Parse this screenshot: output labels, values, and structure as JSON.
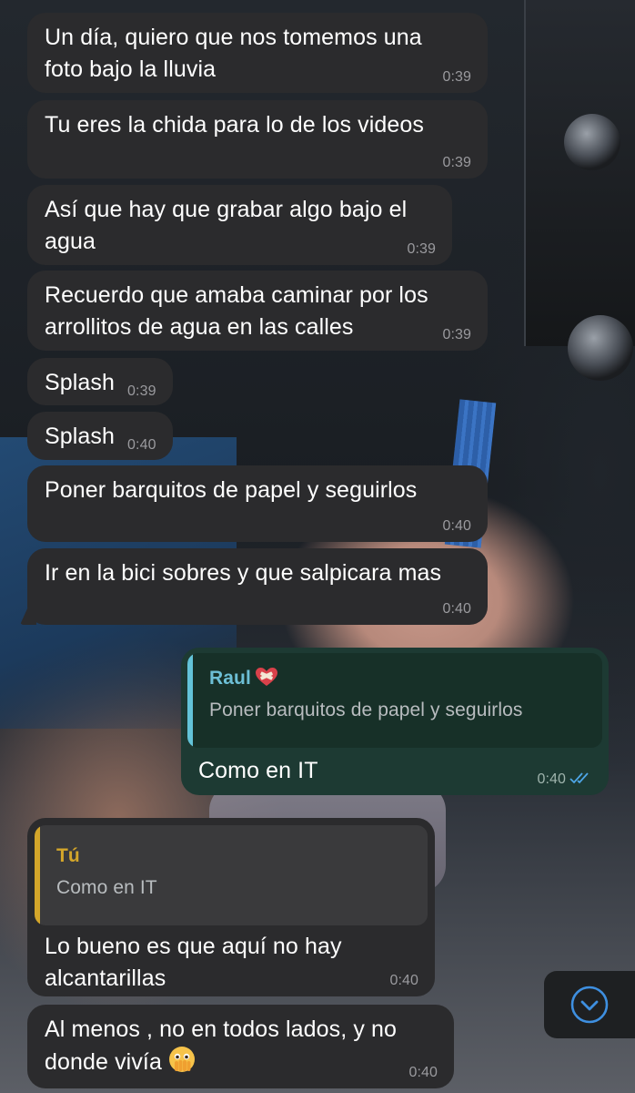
{
  "chat": {
    "contact_name": "Raul",
    "self_name": "Tú",
    "messages": [
      {
        "text": "Un día, quiero que nos tomemos una\nfoto bajo la lluvia",
        "time": "0:39"
      },
      {
        "text": "Tu eres la chida para lo de los videos",
        "time": "0:39"
      },
      {
        "text": "Así que hay que grabar algo bajo el\nagua",
        "time": "0:39"
      },
      {
        "text": "Recuerdo que amaba caminar por los\narrollitos de agua en las calles",
        "time": "0:39"
      },
      {
        "text": "Splash",
        "time": "0:39"
      },
      {
        "text": "Splash",
        "time": "0:40"
      },
      {
        "text": "Poner barquitos de papel y seguirlos",
        "time": "0:40"
      },
      {
        "text": "Ir en la bici sobres y que salpicara mas",
        "time": "0:40"
      },
      {
        "text": "Como en IT",
        "time": "0:40",
        "outgoing": true,
        "reply_to": {
          "author": "Raul",
          "text": "Poner barquitos de papel y seguirlos"
        }
      },
      {
        "text": "Lo bueno es que aquí no hay\nalcantarillas",
        "time": "0:40",
        "reply_to": {
          "author": "Tú",
          "text": "Como en IT"
        }
      },
      {
        "text": "Al menos , no en todos lados, y no\ndonde vivía",
        "time": "0:40",
        "emoji": "face-with-open-eyes-and-hand-over-mouth"
      }
    ]
  },
  "icons": {
    "heart": "mending-heart-icon",
    "read_receipt": "double-check-icon",
    "scroll_down": "chevron-down-circle-icon"
  },
  "colors": {
    "incoming_bubble": "#2b2b2d",
    "outgoing_bubble": "#1d3a33",
    "time_text": "#9a9a9e",
    "quote_bar_out": "#63c3d9",
    "quote_bar_in": "#d4a62a",
    "read_tick": "#4ea6e8",
    "scroll_icon": "#3e8fe0"
  }
}
